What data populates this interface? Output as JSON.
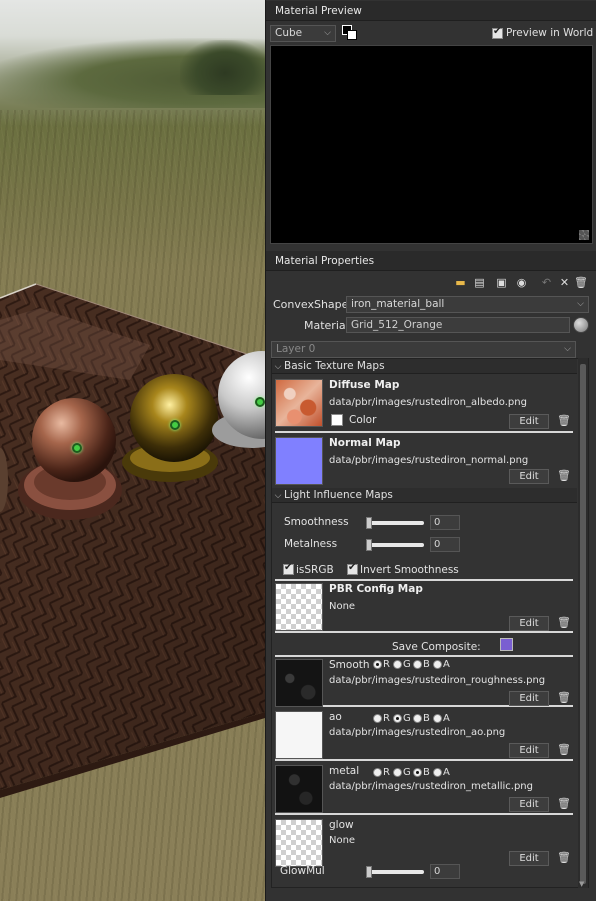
{
  "preview": {
    "header": "Material Preview",
    "shape_select": "Cube",
    "preview_in_world_label": "Preview in World",
    "preview_in_world_checked": true
  },
  "properties": {
    "header": "Material Properties",
    "object_label": "ConvexShape",
    "object_value": "iron_material_ball",
    "material_label": "Material",
    "material_value": "Grid_512_Orange",
    "layer_select": "Layer 0"
  },
  "basic_texture_maps": {
    "header": "Basic Texture Maps",
    "diffuse": {
      "title": "Diffuse Map",
      "path": "data/pbr/images/rustediron_albedo.png",
      "color_label": "Color",
      "edit_label": "Edit"
    },
    "normal": {
      "title": "Normal Map",
      "path": "data/pbr/images/rustediron_normal.png",
      "edit_label": "Edit"
    }
  },
  "light_influence_maps": {
    "header": "Light Influence Maps",
    "smoothness_label": "Smoothness",
    "smoothness_value": "0",
    "metalness_label": "Metalness",
    "metalness_value": "0",
    "is_srgb_label": "isSRGB",
    "invert_smoothness_label": "Invert Smoothness",
    "pbr_config": {
      "title": "PBR Config Map",
      "value": "None",
      "edit_label": "Edit"
    },
    "save_composite_label": "Save Composite:",
    "channel_maps": [
      {
        "name": "Smooth",
        "path": "data/pbr/images/rustediron_roughness.png",
        "selected": "R",
        "edit_label": "Edit"
      },
      {
        "name": "ao",
        "path": "data/pbr/images/rustediron_ao.png",
        "selected": "G",
        "edit_label": "Edit"
      },
      {
        "name": "metal",
        "path": "data/pbr/images/rustediron_metallic.png",
        "selected": "B",
        "edit_label": "Edit"
      }
    ],
    "channels": [
      "R",
      "G",
      "B",
      "A"
    ],
    "glow": {
      "title": "glow",
      "value": "None",
      "edit_label": "Edit",
      "mul_label": "GlowMul",
      "mul_value": "0"
    }
  },
  "colors": {
    "panel_bg": "#323232",
    "header_bg": "#2a2a2a",
    "normal_map_color": "#8080ff",
    "save_icon": "#7a5fd1"
  },
  "icons": {
    "toolbar": [
      "folder-open-icon",
      "document-icon",
      "save-icon",
      "eye-icon",
      "undo-icon",
      "close-icon",
      "trash-icon"
    ]
  }
}
